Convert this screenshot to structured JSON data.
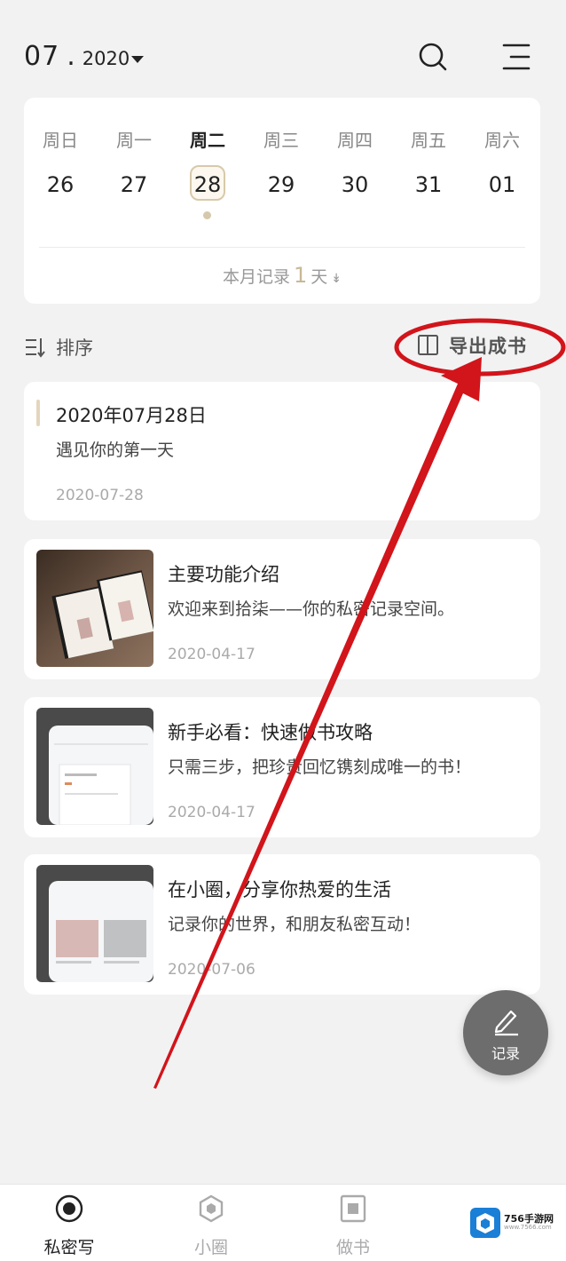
{
  "header": {
    "month": "07",
    "separator": ".",
    "year": "2020"
  },
  "calendar": {
    "weekdays": [
      "周日",
      "周一",
      "周二",
      "周三",
      "周四",
      "周五",
      "周六"
    ],
    "days": [
      "26",
      "27",
      "28",
      "29",
      "30",
      "31",
      "01"
    ],
    "summary_prefix": "本月记录",
    "summary_count": "1",
    "summary_suffix": "天"
  },
  "toolbar": {
    "sort_label": "排序",
    "export_label": "导出成书"
  },
  "entries": [
    {
      "title": "2020年07月28日",
      "desc": "遇见你的第一天",
      "date": "2020-07-28"
    },
    {
      "title": "主要功能介绍",
      "desc": "欢迎来到拾柒——你的私密记录空间。",
      "date": "2020-04-17"
    },
    {
      "title": "新手必看：快速做书攻略",
      "desc": "只需三步，把珍贵回忆镌刻成唯一的书！",
      "date": "2020-04-17"
    },
    {
      "title": "在小圈，分享你热爱的生活",
      "desc": "记录你的世界，和朋友私密互动！",
      "date": "2020-07-06"
    }
  ],
  "fab": {
    "label": "记录"
  },
  "nav": [
    {
      "label": "私密写"
    },
    {
      "label": "小圈"
    },
    {
      "label": "做书"
    }
  ],
  "watermark": {
    "text": "756手游网",
    "sub": "www.7566.com"
  },
  "colors": {
    "accent": "#d8c9ab",
    "annotation_red": "#d2141b",
    "background": "#f2f2f2"
  }
}
